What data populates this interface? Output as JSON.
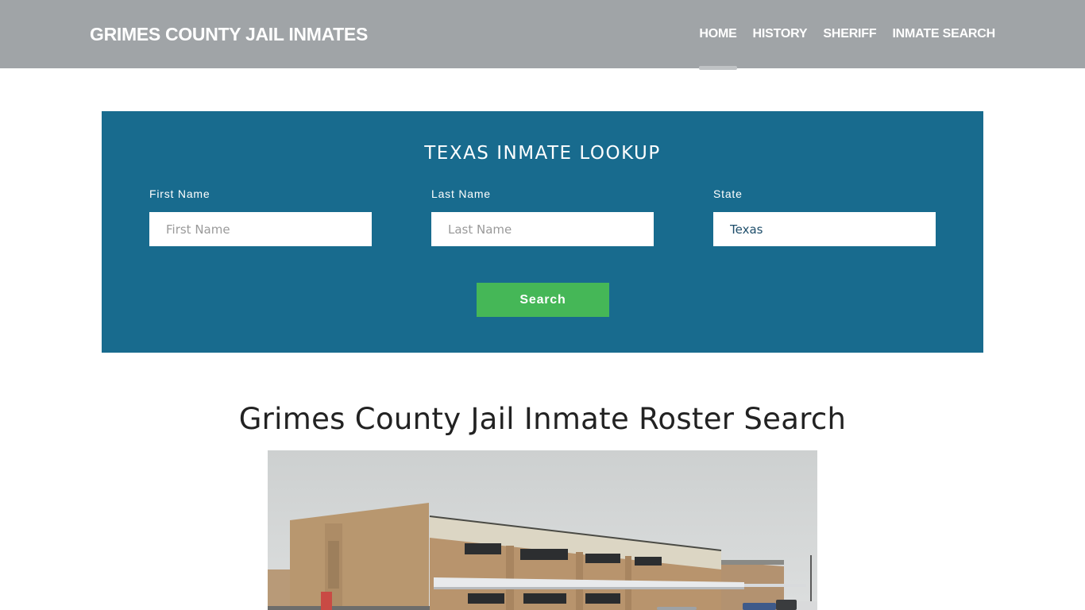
{
  "header": {
    "brand": "GRIMES COUNTY JAIL INMATES",
    "nav": [
      {
        "label": "HOME",
        "active": true
      },
      {
        "label": "HISTORY",
        "active": false
      },
      {
        "label": "SHERIFF",
        "active": false
      },
      {
        "label": "INMATE SEARCH",
        "active": false
      }
    ]
  },
  "lookup": {
    "title": "TEXAS INMATE LOOKUP",
    "fields": {
      "first_name": {
        "label": "First Name",
        "placeholder": "First Name",
        "value": ""
      },
      "last_name": {
        "label": "Last Name",
        "placeholder": "Last Name",
        "value": ""
      },
      "state": {
        "label": "State",
        "placeholder": "",
        "value": "Texas"
      }
    },
    "search_label": "Search",
    "colors": {
      "panel": "#186b8e",
      "button": "#45b757"
    }
  },
  "main": {
    "title": "Grimes County Jail Inmate Roster Search",
    "image_alt": "Grimes County Jail building exterior"
  },
  "colors": {
    "header_bg": "#a0a4a7"
  }
}
